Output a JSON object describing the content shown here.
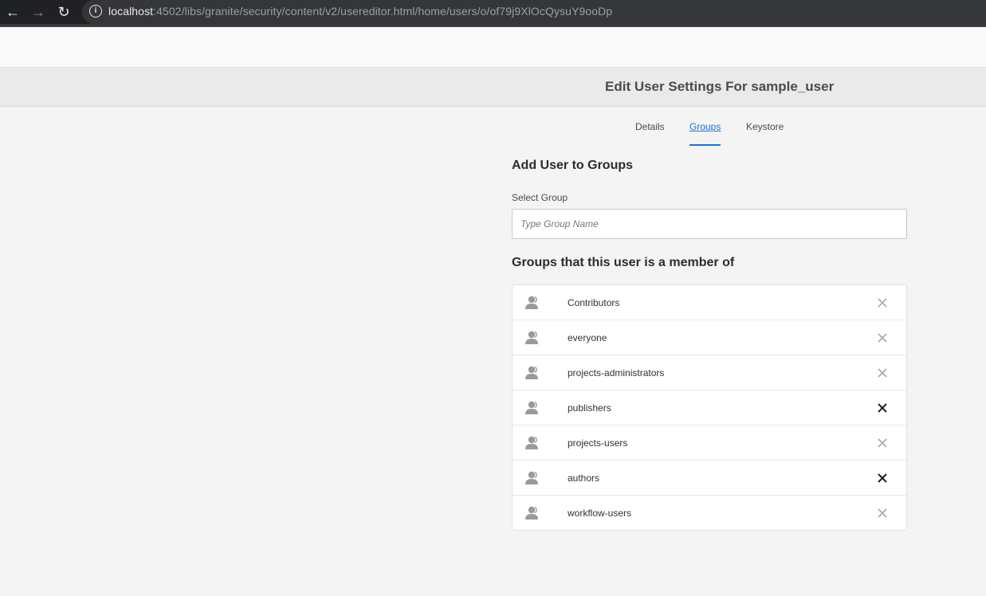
{
  "browser": {
    "url_host": "localhost",
    "url_rest": ":4502/libs/granite/security/content/v2/usereditor.html/home/users/o/of79j9XlOcQysuY9ooDp"
  },
  "header": {
    "title": "Edit User Settings For sample_user"
  },
  "tabs": [
    {
      "label": "Details",
      "active": false
    },
    {
      "label": "Groups",
      "active": true
    },
    {
      "label": "Keystore",
      "active": false
    }
  ],
  "add_section": {
    "heading": "Add User to Groups",
    "select_label": "Select Group",
    "input_placeholder": "Type Group Name",
    "input_value": ""
  },
  "groups_section": {
    "heading": "Groups that this user is a member of",
    "items": [
      {
        "name": "Contributors",
        "remove_emphasized": false
      },
      {
        "name": "everyone",
        "remove_emphasized": false
      },
      {
        "name": "projects-administrators",
        "remove_emphasized": false
      },
      {
        "name": "publishers",
        "remove_emphasized": true
      },
      {
        "name": "projects-users",
        "remove_emphasized": false
      },
      {
        "name": "authors",
        "remove_emphasized": true
      },
      {
        "name": "workflow-users",
        "remove_emphasized": false
      }
    ]
  },
  "colors": {
    "accent": "#1473e6",
    "remove_muted": "#a8a8a8",
    "remove_strong": "#1f1f1f",
    "user_icon": "#9a9a9a"
  },
  "icons": {
    "group_item": "user-icon",
    "remove": "close-icon"
  }
}
